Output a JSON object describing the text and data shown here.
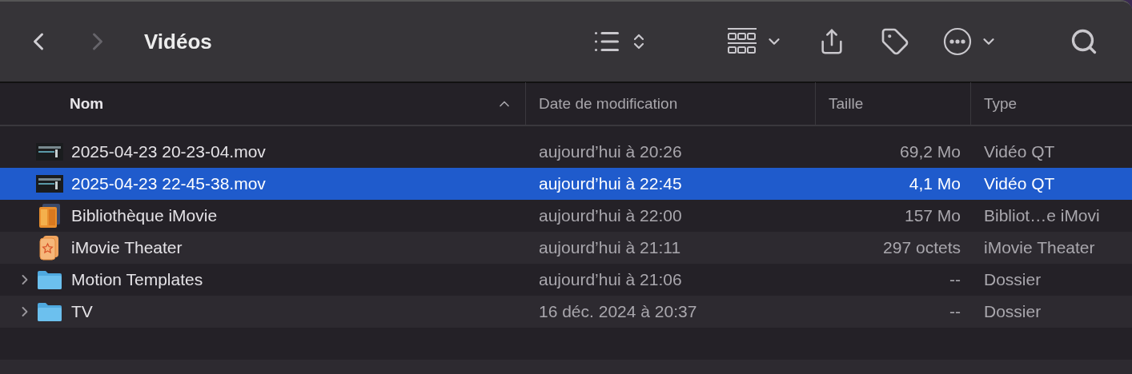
{
  "toolbar": {
    "title": "Vidéos",
    "nav": [
      {
        "kind": "back",
        "disabled": false
      },
      {
        "kind": "forward",
        "disabled": true
      }
    ]
  },
  "table": {
    "columns": [
      {
        "label": "Nom",
        "sorted": true
      },
      {
        "label": "Date de modification",
        "sorted": false
      },
      {
        "label": "Taille",
        "sorted": false
      },
      {
        "label": "Type",
        "sorted": false
      }
    ],
    "rows": [
      {
        "kind": "video",
        "name": "2025-04-23 20-23-04.mov",
        "date": "aujourd’hui à 20:26",
        "size": "69,2 Mo",
        "type": "Vidéo QT",
        "selected": false
      },
      {
        "kind": "video",
        "name": "2025-04-23 22-45-38.mov",
        "date": "aujourd’hui à 22:45",
        "size": "4,1 Mo",
        "type": "Vidéo QT",
        "selected": true
      },
      {
        "kind": "library",
        "name": "Bibliothèque iMovie",
        "date": "aujourd’hui à 22:00",
        "size": "157 Mo",
        "type": "Bibliot…e iMovi",
        "selected": false
      },
      {
        "kind": "theater",
        "name": "iMovie Theater",
        "date": "aujourd’hui à 21:11",
        "size": "297 octets",
        "type": "iMovie Theater",
        "selected": false
      },
      {
        "kind": "folder",
        "name": "Motion Templates",
        "date": "aujourd’hui à 21:06",
        "size": "--",
        "type": "Dossier",
        "selected": false,
        "expanded": false
      },
      {
        "kind": "folder",
        "name": "TV",
        "date": "16 déc. 2024 à 20:37",
        "size": "--",
        "type": "Dossier",
        "selected": false,
        "expanded": false
      }
    ]
  }
}
